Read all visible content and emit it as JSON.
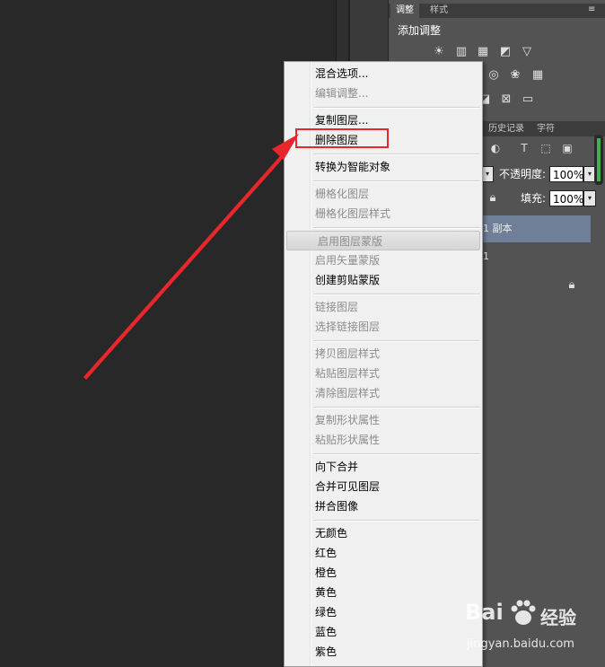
{
  "adjust_panel": {
    "tab_active": "调整",
    "tab_inactive": "样式",
    "title": "添加调整"
  },
  "layers_panel": {
    "tabs": [
      "历史记录",
      "字符"
    ],
    "opacity_label": "不透明度:",
    "opacity_value": "100%",
    "fill_label": "填充:",
    "fill_value": "100%",
    "layers": [
      "1 副本",
      "1"
    ]
  },
  "context_menu": {
    "items": [
      {
        "label": "混合选项...",
        "disabled": false
      },
      {
        "label": "编辑调整...",
        "disabled": true
      },
      {
        "label": "复制图层...",
        "disabled": false
      },
      {
        "label": "删除图层",
        "disabled": false
      },
      {
        "label": "转换为智能对象",
        "disabled": false
      },
      {
        "label": "栅格化图层",
        "disabled": true
      },
      {
        "label": "栅格化图层样式",
        "disabled": true
      },
      {
        "label": "启用图层蒙版",
        "disabled": true
      },
      {
        "label": "启用矢量蒙版",
        "disabled": true
      },
      {
        "label": "创建剪贴蒙版",
        "disabled": false
      },
      {
        "label": "链接图层",
        "disabled": true
      },
      {
        "label": "选择链接图层",
        "disabled": true
      },
      {
        "label": "拷贝图层样式",
        "disabled": true
      },
      {
        "label": "粘贴图层样式",
        "disabled": true
      },
      {
        "label": "清除图层样式",
        "disabled": true
      },
      {
        "label": "复制形状属性",
        "disabled": true
      },
      {
        "label": "粘贴形状属性",
        "disabled": true
      },
      {
        "label": "向下合并",
        "disabled": false
      },
      {
        "label": "合并可见图层",
        "disabled": false
      },
      {
        "label": "拼合图像",
        "disabled": false
      },
      {
        "label": "无颜色",
        "disabled": false
      },
      {
        "label": "红色",
        "disabled": false
      },
      {
        "label": "橙色",
        "disabled": false
      },
      {
        "label": "黄色",
        "disabled": false
      },
      {
        "label": "绿色",
        "disabled": false
      },
      {
        "label": "蓝色",
        "disabled": false
      },
      {
        "label": "紫色",
        "disabled": false
      }
    ]
  },
  "watermark": {
    "brand": "Bai",
    "brand_suffix": "经验",
    "url": "jingyan.baidu.com"
  },
  "colors": {
    "annotation_red": "#e8262b",
    "menu_bg": "#f0f0f0",
    "panel_bg": "#535353",
    "canvas_bg": "#282828"
  }
}
